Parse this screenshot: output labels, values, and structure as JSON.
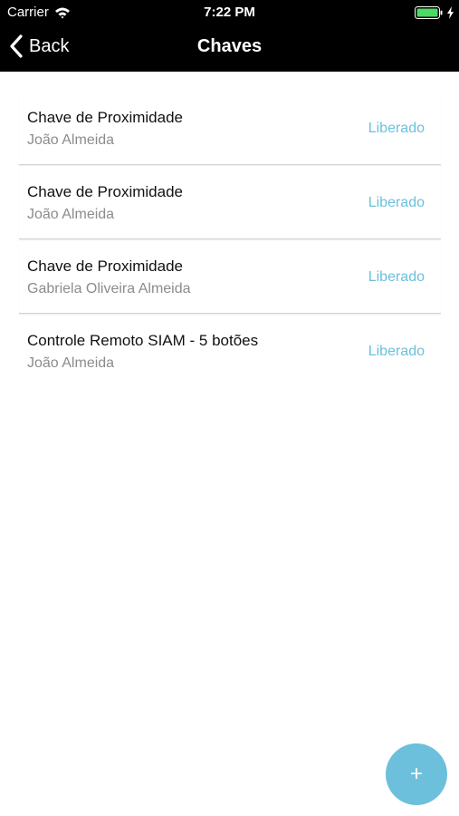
{
  "status_bar": {
    "carrier": "Carrier",
    "time": "7:22 PM"
  },
  "nav": {
    "back_label": "Back",
    "title": "Chaves"
  },
  "keys": [
    {
      "name": "Chave de Proximidade",
      "owner": "João Almeida",
      "status": "Liberado"
    },
    {
      "name": "Chave de Proximidade",
      "owner": "João Almeida",
      "status": "Liberado"
    },
    {
      "name": "Chave de Proximidade",
      "owner": "Gabriela Oliveira Almeida",
      "status": "Liberado"
    },
    {
      "name": "Controle Remoto SIAM - 5 botões",
      "owner": "João Almeida",
      "status": "Liberado"
    }
  ],
  "fab": {
    "icon": "plus-icon",
    "symbol": "+"
  },
  "colors": {
    "accent": "#6cc0db",
    "battery": "#4cd964",
    "nav_background": "#000000"
  }
}
